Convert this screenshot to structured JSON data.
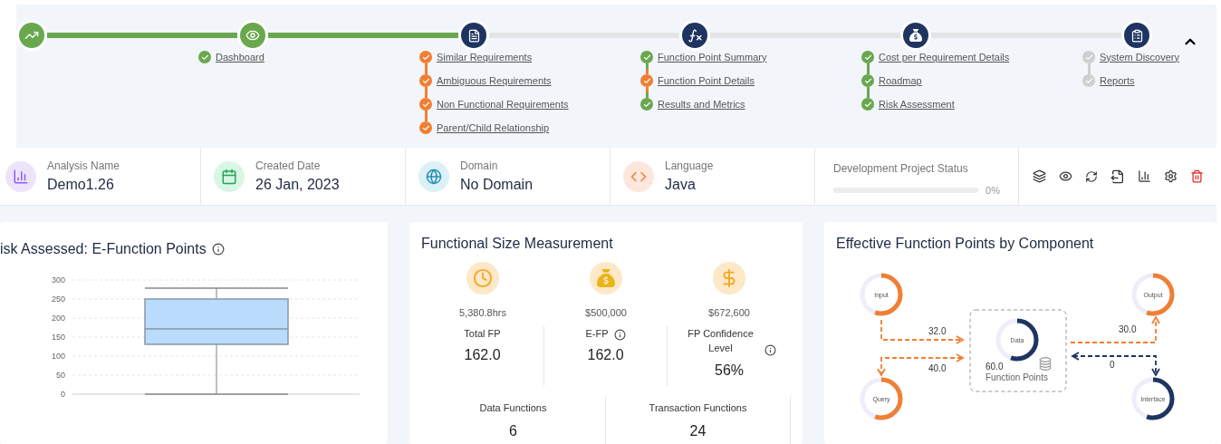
{
  "stepper": {
    "steps": [
      {
        "kind": "chart",
        "done": true
      },
      {
        "kind": "eye",
        "done": true,
        "items": [
          {
            "label": "Dashboard",
            "color": "#6aa84f"
          }
        ]
      },
      {
        "kind": "document",
        "done": false,
        "items": [
          {
            "label": "Similar Requirements",
            "color": "#f07f33"
          },
          {
            "label": "Ambiguous Requirements",
            "color": "#f07f33"
          },
          {
            "label": "Non Functional Requirements",
            "color": "#f07f33"
          },
          {
            "label": "Parent/Child Relationship",
            "color": "#f07f33"
          }
        ]
      },
      {
        "kind": "function",
        "done": false,
        "items": [
          {
            "label": "Function Point Summary",
            "color": "#6aa84f"
          },
          {
            "label": "Function Point Details",
            "color": "#f07f33"
          },
          {
            "label": "Results and Metrics",
            "color": "#6aa84f"
          }
        ]
      },
      {
        "kind": "moneybag",
        "done": false,
        "items": [
          {
            "label": "Cost per Requirement Details",
            "color": "#6aa84f"
          },
          {
            "label": "Roadmap",
            "color": "#6aa84f"
          },
          {
            "label": "Risk Assessment",
            "color": "#6aa84f"
          }
        ]
      },
      {
        "kind": "clipboard",
        "done": false,
        "items": [
          {
            "label": "System Discovery",
            "color": "#cfcfcf"
          },
          {
            "label": "Reports",
            "color": "#cfcfcf"
          }
        ]
      }
    ]
  },
  "summary": [
    {
      "kind": "chart",
      "label": "Analysis Name",
      "value": "Demo1.26",
      "color": "#ede4fb"
    },
    {
      "kind": "calendar",
      "label": "Created Date",
      "value": "26 Jan, 2023",
      "color": "#d9f6e5"
    },
    {
      "kind": "globe",
      "label": "Domain",
      "value": "No Domain",
      "color": "#dcf0f7"
    },
    {
      "kind": "code",
      "label": "Language",
      "value": "Java",
      "color": "#fde7dc"
    },
    {
      "kind": "progress",
      "label": "Development Project Status",
      "level": 0,
      "reading": "0%"
    }
  ],
  "risk_card": {
    "title": "isk Assessed: E-Function Points",
    "axis_labels": [
      "300",
      "250",
      "200",
      "150",
      "100",
      "50",
      "0"
    ]
  },
  "size_card": {
    "title": "Functional Size Measurement",
    "costs": [
      {
        "kind": "clock",
        "value": "5,380.8hrs"
      },
      {
        "kind": "moneybag",
        "value": "$500,000"
      },
      {
        "kind": "dollar",
        "value": "$672,600"
      }
    ],
    "metrics": [
      {
        "label": "Total FP",
        "value": "162.0",
        "info": false
      },
      {
        "label": "E-FP",
        "value": "162.0",
        "info": true
      },
      {
        "label": "FP Confidence Level",
        "value": "56%",
        "info": true
      }
    ],
    "counts": [
      {
        "label": "Data Functions",
        "value": "6"
      },
      {
        "label": "Transaction Functions",
        "value": "24"
      }
    ]
  },
  "component_card": {
    "title": "Effective Function Points by Component",
    "nodes": [
      {
        "label": "Input",
        "color": "#f07f33"
      },
      {
        "label": "Output",
        "color": "#f07f33"
      },
      {
        "label": "Query",
        "color": "#f07f33"
      },
      {
        "label": "Interface",
        "color": "#1e3461"
      }
    ],
    "center": {
      "label": "Data",
      "value": "60.0",
      "caption": "Function Points",
      "color": "#1e3461"
    },
    "flows": [
      {
        "label": "32.0",
        "color": "#f07f33"
      },
      {
        "label": "30.0",
        "color": "#f07f33"
      },
      {
        "label": "40.0",
        "color": "#f07f33"
      },
      {
        "label": "0",
        "color": "#1e3461"
      }
    ]
  }
}
